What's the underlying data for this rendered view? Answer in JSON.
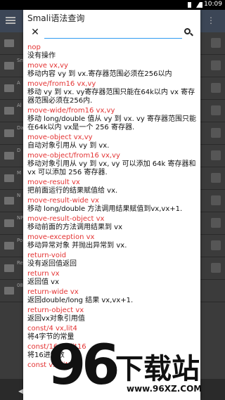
{
  "status_bar": {
    "time": "10:09"
  },
  "background": {
    "rows": [
      "",
      "Sm",
      "A",
      "Al",
      "Da",
      "D",
      "M",
      "N",
      "NP",
      "Po",
      "Re",
      "08"
    ]
  },
  "dialog": {
    "title": "Smali语法查询",
    "search": {
      "value": "",
      "placeholder": ""
    },
    "entries": [
      {
        "op": "nop",
        "desc": "没有操作"
      },
      {
        "op": "move vx,vy",
        "desc": "移动内容 vy 到 vx.寄存器范围必须在256以内"
      },
      {
        "op": "move/from16 vx,vy",
        "desc": "移动 vy 到 vx. vy寄存器范围只能在64k以内 vx 寄存器范围必须在256内."
      },
      {
        "op": "move-wide/from16 vx,vy",
        "desc": "移动 long/double 值从 vy 到 vx. vy 寄存器范围只能在64k以内 vx是一个 256 寄存器."
      },
      {
        "op": "move-object vx,vy",
        "desc": "自动对象引用从 vy 到 vx."
      },
      {
        "op": "move-object/from16 vx,vy",
        "desc": "移动对象引用从 vy 到 vx, vy 可以添加 64k 寄存器和 vx 可以添加 256 寄存器."
      },
      {
        "op": "move-result vx",
        "desc": "把前面运行的结果赋值给 vx."
      },
      {
        "op": "move-result-wide vx",
        "desc": "移动 long/double 方法调用结果赋值到vx,vx+1."
      },
      {
        "op": "move-result-object vx",
        "desc": "移动前面的方法调用结果到 vx"
      },
      {
        "op": "move-exception vx",
        "desc": "移动异常对象 并抛出异常到 vx."
      },
      {
        "op": "return-void",
        "desc": "没有返回值返回"
      },
      {
        "op": "return vx",
        "desc": "返回值 vx"
      },
      {
        "op": "return-wide vx",
        "desc": "返回double/long  结果 vx,vx+1."
      },
      {
        "op": "return-object vx",
        "desc": "返回vx对象引用值"
      },
      {
        "op": "const/4 vx,lit4",
        "desc": "将4字节的常量"
      },
      {
        "op": "const/16 vx,lit16",
        "desc": "将16进制数"
      },
      {
        "op": "const vx, lit32",
        "desc": ""
      }
    ]
  },
  "watermark": {
    "logo_number": "96",
    "logo_text": "下载站",
    "url": "www.96XZ.COM"
  }
}
